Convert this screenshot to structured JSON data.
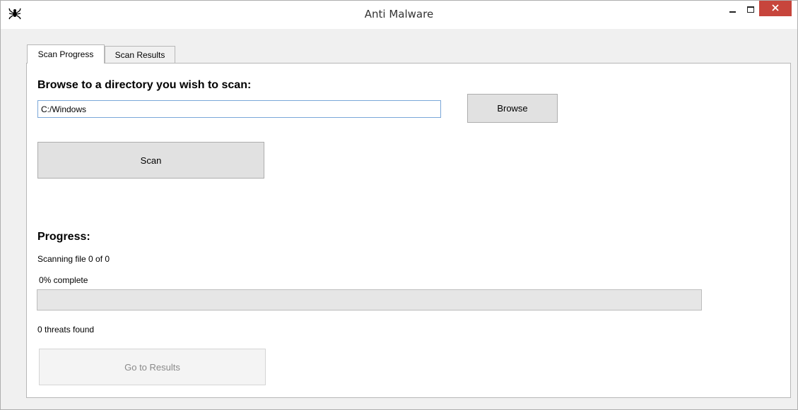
{
  "window": {
    "title": "Anti Malware",
    "icon": "spider-icon",
    "controls": {
      "minimize": "minimize-icon",
      "maximize": "maximize-icon",
      "close": "close-icon"
    }
  },
  "tabs": [
    {
      "label": "Scan Progress",
      "active": true
    },
    {
      "label": "Scan Results",
      "active": false
    }
  ],
  "scan": {
    "browse_heading": "Browse to a directory you wish to scan:",
    "path_value": "C:/Windows",
    "browse_label": "Browse",
    "scan_label": "Scan"
  },
  "progress": {
    "heading": "Progress:",
    "status_text": "Scanning file 0 of 0",
    "percent_text": "0% complete",
    "fraction": 0,
    "threats_text": "0 threats found",
    "results_label": "Go to Results"
  },
  "colors": {
    "close_button": "#c7453c",
    "progress_fill": "#06b025",
    "input_border": "#7aa7d8"
  }
}
